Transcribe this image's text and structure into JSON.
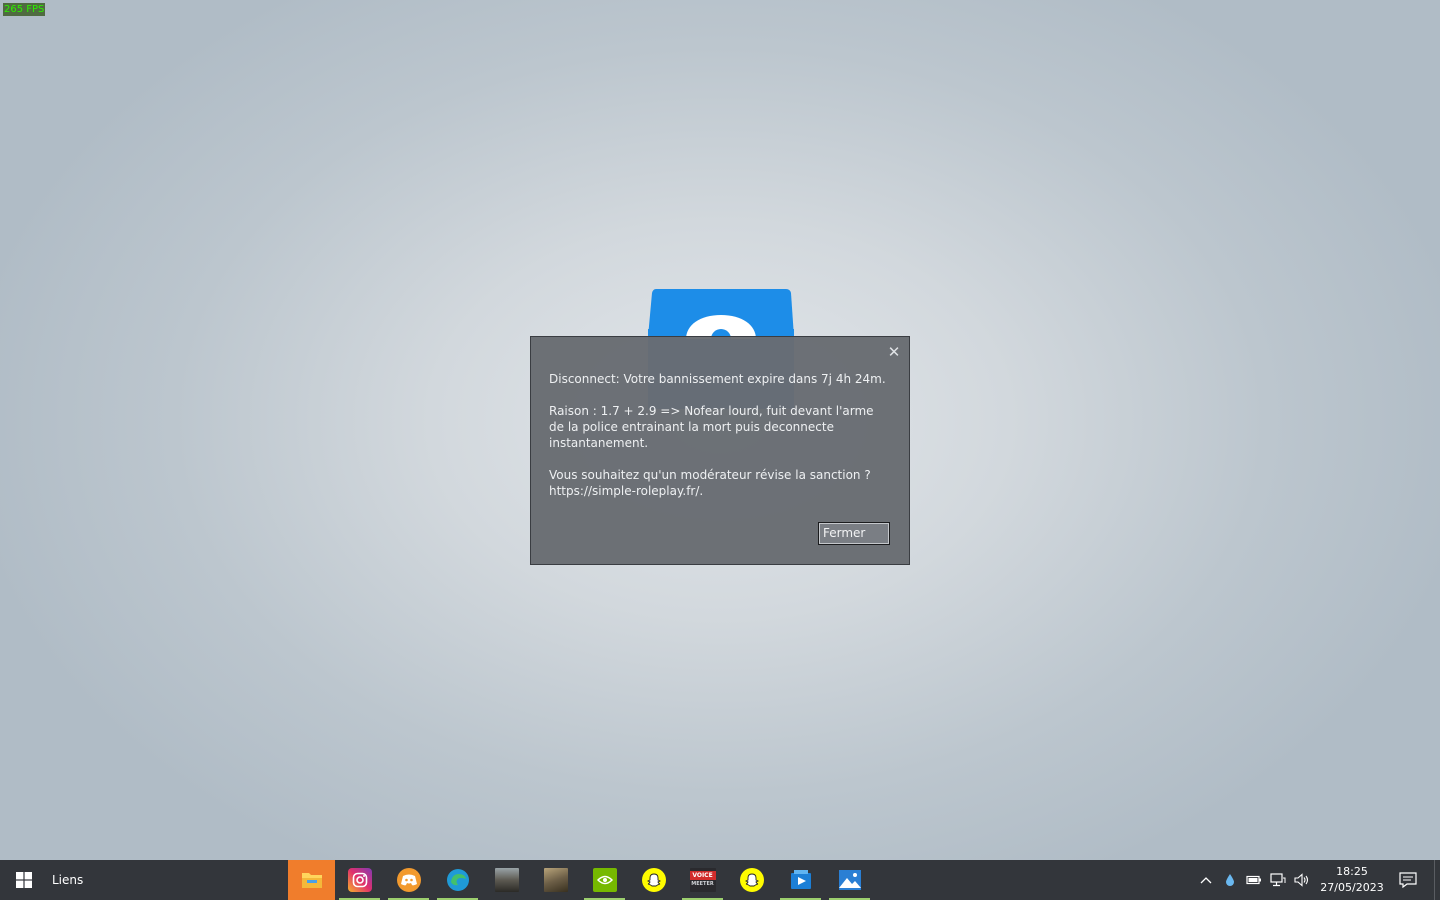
{
  "overlay": {
    "fps": "265 FPS"
  },
  "dialog": {
    "line1": "Disconnect: Votre bannissement expire dans 7j 4h 24m.",
    "reason": "Raison : 1.7 + 2.9 => Nofear lourd, fuit devant l'arme de la police entrainant la mort puis deconnecte instantanement.",
    "appeal_line": "Vous souhaitez qu'un modérateur révise la sanction ?",
    "appeal_url": "https://simple-roleplay.fr/.",
    "close_label": "Fermer",
    "close_icon": "close-icon"
  },
  "taskbar": {
    "toolbar_label": "Liens",
    "apps": [
      {
        "name": "file-explorer",
        "active": true
      },
      {
        "name": "instagram",
        "running": true
      },
      {
        "name": "discord",
        "running": true
      },
      {
        "name": "edge",
        "running": true
      },
      {
        "name": "game-1",
        "running": false
      },
      {
        "name": "game-2",
        "running": false
      },
      {
        "name": "nvidia",
        "running": true
      },
      {
        "name": "snapchat-1",
        "running": false
      },
      {
        "name": "voicemeeter",
        "running": true,
        "label_top": "VOICE",
        "label_bottom": "MEETER"
      },
      {
        "name": "snapchat-2",
        "running": false
      },
      {
        "name": "media-player",
        "running": true
      },
      {
        "name": "photos",
        "running": true
      }
    ],
    "tray": {
      "time": "18:25",
      "date": "27/05/2023"
    }
  },
  "colors": {
    "accent_active_app": "#f07d2c",
    "running_indicator": "#9ccf6e",
    "gmod_blue": "#1d8de8"
  }
}
